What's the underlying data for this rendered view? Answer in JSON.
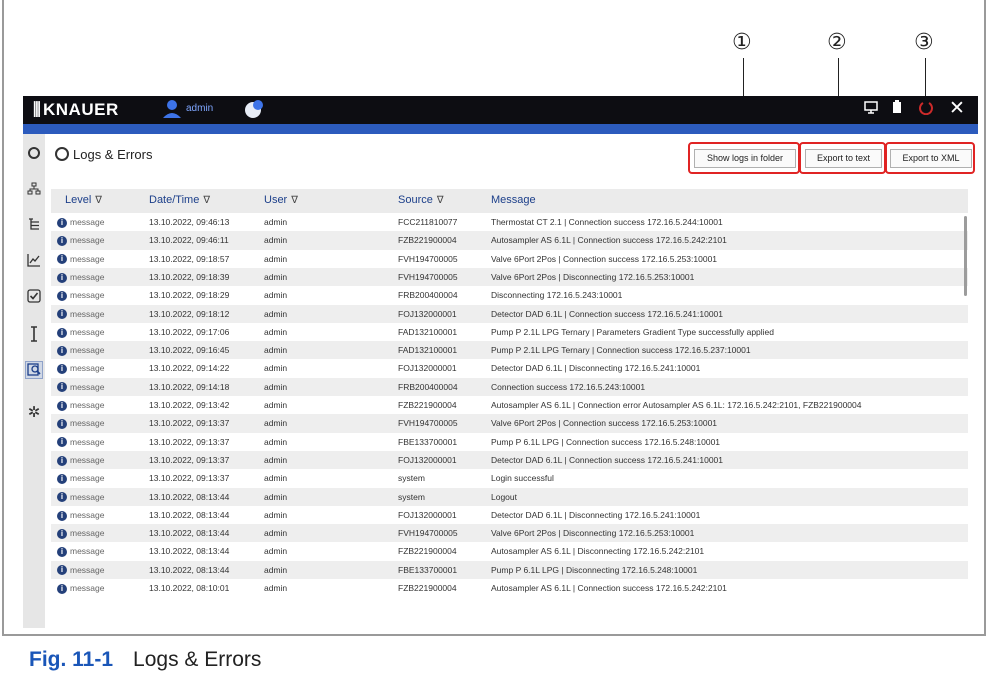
{
  "callouts": [
    "①",
    "②",
    "③"
  ],
  "app": {
    "brand": "KNAUER",
    "user": "admin"
  },
  "sidebar": {
    "icons": [
      "circle-icon",
      "network-icon",
      "tree-icon",
      "chart-icon",
      "checkbox-icon",
      "lamp-icon",
      "logs-icon",
      "gear-icon"
    ]
  },
  "page": {
    "title": "Logs & Errors"
  },
  "toolbar": {
    "show_logs": "Show logs in folder",
    "export_text": "Export to text",
    "export_xml": "Export to XML"
  },
  "table": {
    "headers": [
      "Level",
      "Date/Time",
      "User",
      "Source",
      "Message"
    ],
    "filter_glyph": "∇",
    "rows": [
      [
        "message",
        "13.10.2022, 09:46:13",
        "admin",
        "FCC211810077",
        "Thermostat CT 2.1 | Connection success 172.16.5.244:10001"
      ],
      [
        "message",
        "13.10.2022, 09:46:11",
        "admin",
        "FZB221900004",
        "Autosampler AS 6.1L | Connection success 172.16.5.242:2101"
      ],
      [
        "message",
        "13.10.2022, 09:18:57",
        "admin",
        "FVH194700005",
        "Valve 6Port 2Pos | Connection success 172.16.5.253:10001"
      ],
      [
        "message",
        "13.10.2022, 09:18:39",
        "admin",
        "FVH194700005",
        "Valve 6Port 2Pos | Disconnecting 172.16.5.253:10001"
      ],
      [
        "message",
        "13.10.2022, 09:18:29",
        "admin",
        "FRB200400004",
        "Disconnecting 172.16.5.243:10001"
      ],
      [
        "message",
        "13.10.2022, 09:18:12",
        "admin",
        "FOJ132000001",
        "Detector DAD 6.1L | Connection success 172.16.5.241:10001"
      ],
      [
        "message",
        "13.10.2022, 09:17:06",
        "admin",
        "FAD132100001",
        "Pump P 2.1L LPG Ternary | Parameters Gradient Type successfully applied"
      ],
      [
        "message",
        "13.10.2022, 09:16:45",
        "admin",
        "FAD132100001",
        "Pump P 2.1L LPG Ternary | Connection success 172.16.5.237:10001"
      ],
      [
        "message",
        "13.10.2022, 09:14:22",
        "admin",
        "FOJ132000001",
        "Detector DAD 6.1L | Disconnecting 172.16.5.241:10001"
      ],
      [
        "message",
        "13.10.2022, 09:14:18",
        "admin",
        "FRB200400004",
        "Connection success 172.16.5.243:10001"
      ],
      [
        "message",
        "13.10.2022, 09:13:42",
        "admin",
        "FZB221900004",
        "Autosampler AS 6.1L | Connection error Autosampler AS 6.1L: 172.16.5.242:2101, FZB221900004"
      ],
      [
        "message",
        "13.10.2022, 09:13:37",
        "admin",
        "FVH194700005",
        "Valve 6Port 2Pos | Connection success 172.16.5.253:10001"
      ],
      [
        "message",
        "13.10.2022, 09:13:37",
        "admin",
        "FBE133700001",
        "Pump P 6.1L LPG | Connection success 172.16.5.248:10001"
      ],
      [
        "message",
        "13.10.2022, 09:13:37",
        "admin",
        "FOJ132000001",
        "Detector DAD 6.1L | Connection success 172.16.5.241:10001"
      ],
      [
        "message",
        "13.10.2022, 09:13:37",
        "admin",
        "system",
        "Login successful"
      ],
      [
        "message",
        "13.10.2022, 08:13:44",
        "admin",
        "system",
        "Logout"
      ],
      [
        "message",
        "13.10.2022, 08:13:44",
        "admin",
        "FOJ132000001",
        "Detector DAD 6.1L | Disconnecting 172.16.5.241:10001"
      ],
      [
        "message",
        "13.10.2022, 08:13:44",
        "admin",
        "FVH194700005",
        "Valve 6Port 2Pos | Disconnecting 172.16.5.253:10001"
      ],
      [
        "message",
        "13.10.2022, 08:13:44",
        "admin",
        "FZB221900004",
        "Autosampler AS 6.1L | Disconnecting 172.16.5.242:2101"
      ],
      [
        "message",
        "13.10.2022, 08:13:44",
        "admin",
        "FBE133700001",
        "Pump P 6.1L LPG | Disconnecting 172.16.5.248:10001"
      ],
      [
        "message",
        "13.10.2022, 08:10:01",
        "admin",
        "FZB221900004",
        "Autosampler AS 6.1L | Connection success 172.16.5.242:2101"
      ]
    ]
  },
  "caption": {
    "number": "Fig. 11-1",
    "text": "Logs & Errors"
  },
  "colors": {
    "titlebar": "#0d0d12",
    "accent": "#2c5bbd",
    "highlight_ring": "#e02424",
    "caption_number": "#1a56b8"
  }
}
